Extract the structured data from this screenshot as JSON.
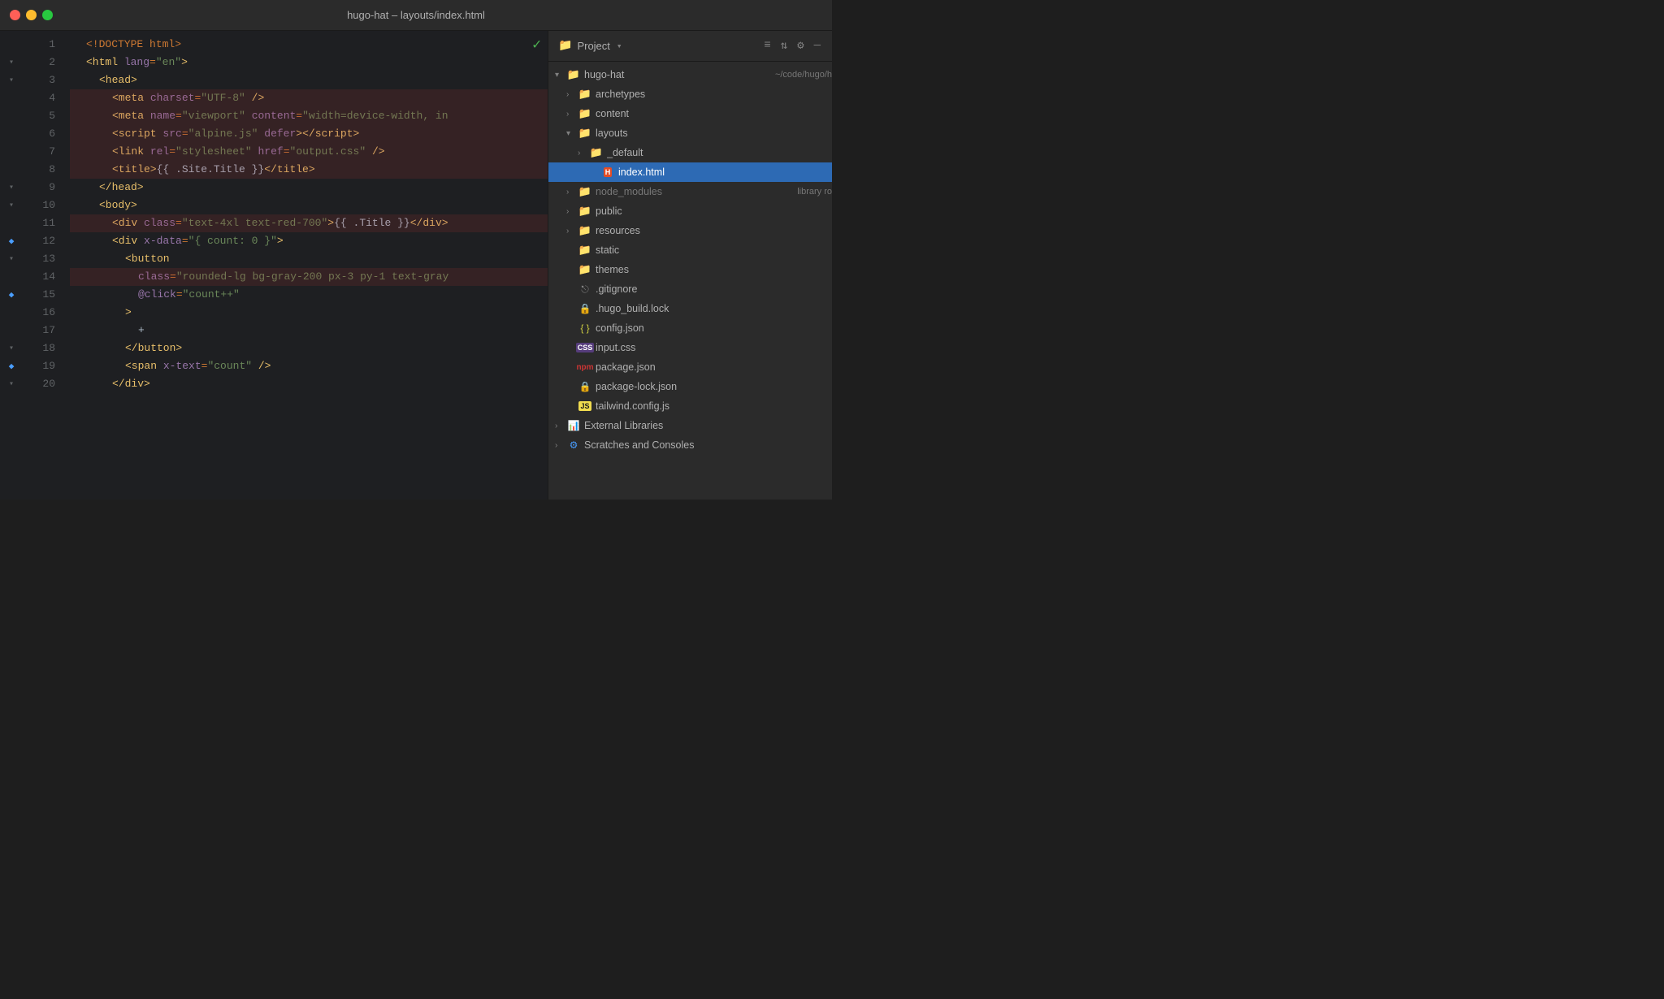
{
  "titlebar": {
    "title": "hugo-hat – layouts/index.html",
    "buttons": [
      "close",
      "minimize",
      "maximize"
    ]
  },
  "editor": {
    "checkmark": "✓",
    "lines": [
      {
        "num": 1,
        "gutter": "",
        "indent": 0,
        "content": [
          {
            "type": "punct",
            "t": "<!DOCTYPE "
          },
          {
            "type": "kw",
            "t": "html"
          },
          {
            "type": "punct",
            "t": ">"
          }
        ],
        "bg": false
      },
      {
        "num": 2,
        "gutter": "fold",
        "indent": 0,
        "content": [
          {
            "type": "tag",
            "t": "<html"
          },
          {
            "type": "space",
            "t": " "
          },
          {
            "type": "attr",
            "t": "lang"
          },
          {
            "type": "punct",
            "t": "="
          },
          {
            "type": "str",
            "t": "\"en\""
          },
          {
            "type": "tag",
            "t": ">"
          }
        ],
        "bg": false
      },
      {
        "num": 3,
        "gutter": "fold",
        "indent": 1,
        "content": [
          {
            "type": "tag",
            "t": "<head>"
          }
        ],
        "bg": false
      },
      {
        "num": 4,
        "gutter": "",
        "indent": 2,
        "content": [
          {
            "type": "tag",
            "t": "<meta"
          },
          {
            "type": "space",
            "t": " "
          },
          {
            "type": "attr",
            "t": "charset"
          },
          {
            "type": "punct",
            "t": "="
          },
          {
            "type": "str",
            "t": "\"UTF-8\""
          },
          {
            "type": "space",
            "t": " "
          },
          {
            "type": "tag",
            "t": "/>"
          }
        ],
        "bg": true
      },
      {
        "num": 5,
        "gutter": "",
        "indent": 2,
        "content": [
          {
            "type": "tag",
            "t": "<meta"
          },
          {
            "type": "space",
            "t": " "
          },
          {
            "type": "attr",
            "t": "name"
          },
          {
            "type": "punct",
            "t": "="
          },
          {
            "type": "str",
            "t": "\"viewport\""
          },
          {
            "type": "space",
            "t": " "
          },
          {
            "type": "attr",
            "t": "content"
          },
          {
            "type": "punct",
            "t": "="
          },
          {
            "type": "str",
            "t": "\"width=device-width, in"
          }
        ],
        "bg": true
      },
      {
        "num": 6,
        "gutter": "",
        "indent": 2,
        "content": [
          {
            "type": "tag",
            "t": "<script"
          },
          {
            "type": "space",
            "t": " "
          },
          {
            "type": "attr",
            "t": "src"
          },
          {
            "type": "punct",
            "t": "="
          },
          {
            "type": "str",
            "t": "\"alpine.js\""
          },
          {
            "type": "space",
            "t": " "
          },
          {
            "type": "attr",
            "t": "defer"
          },
          {
            "type": "tag",
            "t": "></"
          },
          {
            "type": "tag",
            "t": "script>"
          }
        ],
        "bg": true
      },
      {
        "num": 7,
        "gutter": "",
        "indent": 2,
        "content": [
          {
            "type": "tag",
            "t": "<link"
          },
          {
            "type": "space",
            "t": " "
          },
          {
            "type": "attr",
            "t": "rel"
          },
          {
            "type": "punct",
            "t": "="
          },
          {
            "type": "str",
            "t": "\"stylesheet\""
          },
          {
            "type": "space",
            "t": " "
          },
          {
            "type": "attr",
            "t": "href"
          },
          {
            "type": "punct",
            "t": "="
          },
          {
            "type": "str",
            "t": "\"output.css\""
          },
          {
            "type": "space",
            "t": " "
          },
          {
            "type": "tag",
            "t": "/>"
          }
        ],
        "bg": true
      },
      {
        "num": 8,
        "gutter": "",
        "indent": 2,
        "content": [
          {
            "type": "tag",
            "t": "<title>"
          },
          {
            "type": "tmpl",
            "t": "{{ .Site.Title }}"
          },
          {
            "type": "tag",
            "t": "</title>"
          }
        ],
        "bg": true
      },
      {
        "num": 9,
        "gutter": "fold",
        "indent": 1,
        "content": [
          {
            "type": "tag",
            "t": "</head>"
          }
        ],
        "bg": false
      },
      {
        "num": 10,
        "gutter": "fold",
        "indent": 1,
        "content": [
          {
            "type": "tag",
            "t": "<body>"
          }
        ],
        "bg": false
      },
      {
        "num": 11,
        "gutter": "",
        "indent": 2,
        "content": [
          {
            "type": "tag",
            "t": "<div"
          },
          {
            "type": "space",
            "t": " "
          },
          {
            "type": "attr",
            "t": "class"
          },
          {
            "type": "punct",
            "t": "="
          },
          {
            "type": "str",
            "t": "\"text-4xl text-red-700\""
          },
          {
            "type": "tag",
            "t": ">"
          },
          {
            "type": "tmpl",
            "t": "{{ .Title }}"
          },
          {
            "type": "tag",
            "t": "</div>"
          }
        ],
        "bg": true
      },
      {
        "num": 12,
        "gutter": "diamond",
        "indent": 2,
        "content": [
          {
            "type": "tag",
            "t": "<div"
          },
          {
            "type": "space",
            "t": " "
          },
          {
            "type": "attr",
            "t": "x-data"
          },
          {
            "type": "punct",
            "t": "="
          },
          {
            "type": "str",
            "t": "\"{ count: 0 }\""
          },
          {
            "type": "tag",
            "t": ">"
          }
        ],
        "bg": false
      },
      {
        "num": 13,
        "gutter": "fold",
        "indent": 3,
        "content": [
          {
            "type": "tag",
            "t": "<button"
          }
        ],
        "bg": false
      },
      {
        "num": 14,
        "gutter": "",
        "indent": 4,
        "content": [
          {
            "type": "attr",
            "t": "class"
          },
          {
            "type": "punct",
            "t": "="
          },
          {
            "type": "str",
            "t": "\"rounded-lg bg-gray-200 px-3 py-1 text-gray"
          }
        ],
        "bg": true
      },
      {
        "num": 15,
        "gutter": "diamond",
        "indent": 4,
        "content": [
          {
            "type": "alpine",
            "t": "@click"
          },
          {
            "type": "punct",
            "t": "="
          },
          {
            "type": "str",
            "t": "\"count++\""
          }
        ],
        "bg": false
      },
      {
        "num": 16,
        "gutter": "",
        "indent": 3,
        "content": [
          {
            "type": "tag",
            "t": ">"
          }
        ],
        "bg": false
      },
      {
        "num": 17,
        "gutter": "",
        "indent": 4,
        "content": [
          {
            "type": "plus",
            "t": "+"
          }
        ],
        "bg": false
      },
      {
        "num": 18,
        "gutter": "fold",
        "indent": 3,
        "content": [
          {
            "type": "tag",
            "t": "</button>"
          }
        ],
        "bg": false
      },
      {
        "num": 19,
        "gutter": "diamond",
        "indent": 3,
        "content": [
          {
            "type": "tag",
            "t": "<span"
          },
          {
            "type": "space",
            "t": " "
          },
          {
            "type": "alpine",
            "t": "x-text"
          },
          {
            "type": "punct",
            "t": "="
          },
          {
            "type": "str",
            "t": "\"count\""
          },
          {
            "type": "space",
            "t": " "
          },
          {
            "type": "tag",
            "t": "/>"
          }
        ],
        "bg": false
      },
      {
        "num": 20,
        "gutter": "fold",
        "indent": 2,
        "content": [
          {
            "type": "tag",
            "t": "</div>"
          }
        ],
        "bg": false
      }
    ]
  },
  "sidebar": {
    "title": "Project",
    "chevron": "▾",
    "icons": [
      "list-filter",
      "list-layout",
      "gear"
    ],
    "tree": [
      {
        "id": "hugo-hat",
        "label": "hugo-hat",
        "badge": "~/code/hugo/h",
        "type": "root-folder",
        "depth": 0,
        "expanded": true,
        "arrow": "▾"
      },
      {
        "id": "archetypes",
        "label": "archetypes",
        "type": "folder",
        "depth": 1,
        "expanded": false,
        "arrow": "›"
      },
      {
        "id": "content",
        "label": "content",
        "type": "folder",
        "depth": 1,
        "expanded": false,
        "arrow": "›"
      },
      {
        "id": "layouts",
        "label": "layouts",
        "type": "folder",
        "depth": 1,
        "expanded": true,
        "arrow": "▾"
      },
      {
        "id": "_default",
        "label": "_default",
        "type": "folder",
        "depth": 2,
        "expanded": false,
        "arrow": "›"
      },
      {
        "id": "index.html",
        "label": "index.html",
        "type": "html",
        "depth": 3,
        "selected": true
      },
      {
        "id": "node_modules",
        "label": "node_modules",
        "badge": "library ro",
        "type": "folder-grey",
        "depth": 1,
        "expanded": false,
        "arrow": "›"
      },
      {
        "id": "public",
        "label": "public",
        "type": "folder",
        "depth": 1,
        "expanded": false,
        "arrow": "›"
      },
      {
        "id": "resources",
        "label": "resources",
        "type": "folder",
        "depth": 1,
        "expanded": false,
        "arrow": "›"
      },
      {
        "id": "static",
        "label": "static",
        "type": "folder",
        "depth": 1,
        "expanded": false,
        "arrow": ""
      },
      {
        "id": "themes",
        "label": "themes",
        "type": "folder-noarrow",
        "depth": 1,
        "expanded": false,
        "arrow": ""
      },
      {
        "id": ".gitignore",
        "label": ".gitignore",
        "type": "git",
        "depth": 1
      },
      {
        "id": ".hugo_build.lock",
        "label": ".hugo_build.lock",
        "type": "lock",
        "depth": 1
      },
      {
        "id": "config.json",
        "label": "config.json",
        "type": "json",
        "depth": 1
      },
      {
        "id": "input.css",
        "label": "input.css",
        "type": "css",
        "depth": 1
      },
      {
        "id": "package.json",
        "label": "package.json",
        "type": "npm",
        "depth": 1
      },
      {
        "id": "package-lock.json",
        "label": "package-lock.json",
        "type": "lock",
        "depth": 1
      },
      {
        "id": "tailwind.config.js",
        "label": "tailwind.config.js",
        "type": "js",
        "depth": 1
      },
      {
        "id": "external-libraries",
        "label": "External Libraries",
        "type": "libraries",
        "depth": 0,
        "arrow": "›"
      },
      {
        "id": "scratches",
        "label": "Scratches and Consoles",
        "type": "scratches",
        "depth": 0,
        "arrow": "›"
      }
    ]
  }
}
